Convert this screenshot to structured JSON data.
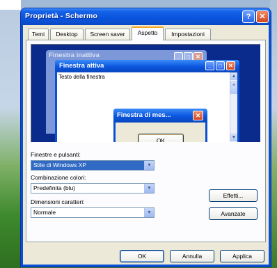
{
  "window": {
    "title": "Proprietà - Schermo",
    "help_label": "?",
    "close_label": "✕"
  },
  "tabs": [
    {
      "label": "Temi"
    },
    {
      "label": "Desktop"
    },
    {
      "label": "Screen saver"
    },
    {
      "label": "Aspetto",
      "active": true
    },
    {
      "label": "Impostazioni"
    }
  ],
  "preview": {
    "inactive_title": "Finestra inattiva",
    "active_title": "Finestra attiva",
    "window_text": "Testo della finestra",
    "message_title": "Finestra di mes...",
    "message_ok": "OK",
    "min_label": "_",
    "max_label": "□",
    "close_label": "✕"
  },
  "form": {
    "windows_label": "Finestre e pulsanti:",
    "windows_value": "Stile di Windows XP",
    "color_label": "Combinazione colori:",
    "color_value": "Predefinita (blu)",
    "font_label": "Dimensioni caratteri:",
    "font_value": "Normale",
    "effects_button": "Effetti...",
    "advanced_button": "Avanzate"
  },
  "footer": {
    "ok": "OK",
    "cancel": "Annulla",
    "apply": "Applica"
  },
  "colors": {
    "title_blue": "#0a50d6",
    "dialog_bg": "#ece9d8",
    "selection_blue": "#316ac5",
    "close_red": "#d2461f"
  }
}
